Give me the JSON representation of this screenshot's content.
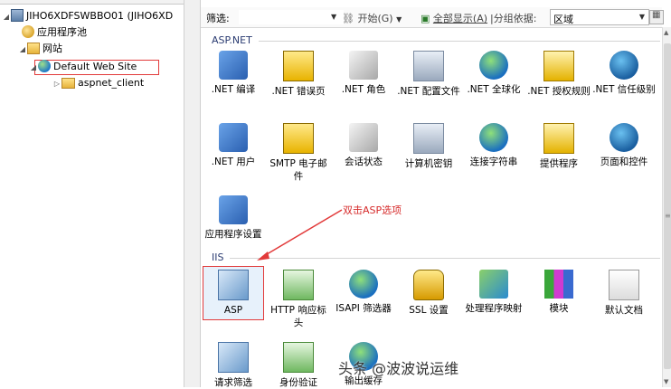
{
  "tree": {
    "server": "JIHO6XDFSWBBO01 (JIHO6XD",
    "app_pools": "应用程序池",
    "sites": "网站",
    "default_site": "Default Web Site",
    "child_folder": "aspnet_client"
  },
  "filterbar": {
    "filter_label": "筛选:",
    "start": "开始(G)",
    "show_all": "全部显示(A)",
    "group_by": "分组依据:",
    "group_value": "区域"
  },
  "sections": {
    "aspnet": "ASP.NET",
    "iis": "IIS"
  },
  "aspnet_items": [
    ".NET 编译",
    ".NET 错误页",
    ".NET 角色",
    ".NET 配置文件",
    ".NET 全球化",
    ".NET 授权规则",
    ".NET 信任级别",
    ".NET 用户",
    "SMTP 电子邮件",
    "会话状态",
    "计算机密钥",
    "连接字符串",
    "提供程序",
    "页面和控件",
    "应用程序设置"
  ],
  "iis_items": [
    "ASP",
    "HTTP 响应标头",
    "ISAPI 筛选器",
    "SSL 设置",
    "处理程序映射",
    "模块",
    "默认文档",
    "请求筛选",
    "身份验证",
    "输出缓存"
  ],
  "annotation": "双击ASP选项",
  "watermark": "头条 @波波说运维",
  "colors": {
    "highlight_border": "#e23a3a",
    "section_text": "#2b3c72",
    "annotation": "#d62b2b"
  }
}
